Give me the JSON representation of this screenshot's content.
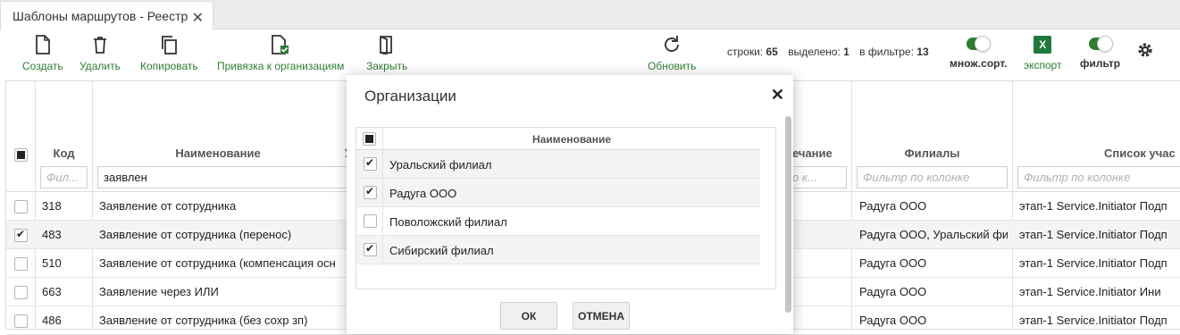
{
  "tab": {
    "title": "Шаблоны маршрутов - Реестр"
  },
  "toolbar": {
    "create": "Создать",
    "delete": "Удалить",
    "copy": "Копировать",
    "bind_org": "Привязка к организациям",
    "close": "Закрыть",
    "refresh": "Обновить",
    "stats": {
      "rows_label": "строки:",
      "rows": "65",
      "selected_label": "выделено:",
      "selected": "1",
      "filter_label": "в фильтре:",
      "filter": "13"
    },
    "multisort": "множ.сорт.",
    "export": "экспорт",
    "excel_letter": "X",
    "filter": "фильтр"
  },
  "grid": {
    "headers": {
      "code": "Код",
      "name": "Наименование",
      "name_trail": "У",
      "note": "ечание",
      "branches": "Филиалы",
      "participants": "Список учас"
    },
    "filters": {
      "code": "Фил...",
      "name": "заявлен",
      "note": "р по к...",
      "branches": "Фильтр по колонке",
      "participants": "Фильтр по колонке"
    },
    "rows": [
      {
        "checked": false,
        "code": "318",
        "name": "Заявление от сотрудника",
        "branches": "Радуга ООО",
        "participants": "этап-1 Service.Initiator Подп"
      },
      {
        "checked": true,
        "code": "483",
        "name": "Заявление от сотрудника (перенос)",
        "branches": "Радуга ООО, Уральский фи",
        "participants": "этап-1 Service.Initiator Подп"
      },
      {
        "checked": false,
        "code": "510",
        "name": "Заявление от сотрудника (компенсация осн",
        "branches": "Радуга ООО",
        "participants": "этап-1 Service.Initiator Подп"
      },
      {
        "checked": false,
        "code": "663",
        "name": "Заявление через ИЛИ",
        "branches": "Радуга ООО",
        "participants": "этап-1 Service.Initiator Ини"
      },
      {
        "checked": false,
        "code": "486",
        "name": "Заявление от сотрудника (без сохр зп)",
        "branches": "Радуга ООО",
        "participants": "этап-1 Service.Initiator Подп"
      }
    ]
  },
  "dialog": {
    "title": "Организации",
    "column": "Наименование",
    "items": [
      {
        "label": "Уральский филиал",
        "checked": true
      },
      {
        "label": "Радуга ООО",
        "checked": true
      },
      {
        "label": "Поволожский филиал",
        "checked": false
      },
      {
        "label": "Сибирский филиал",
        "checked": true
      }
    ],
    "ok": "ОК",
    "cancel": "ОТМЕНА"
  }
}
